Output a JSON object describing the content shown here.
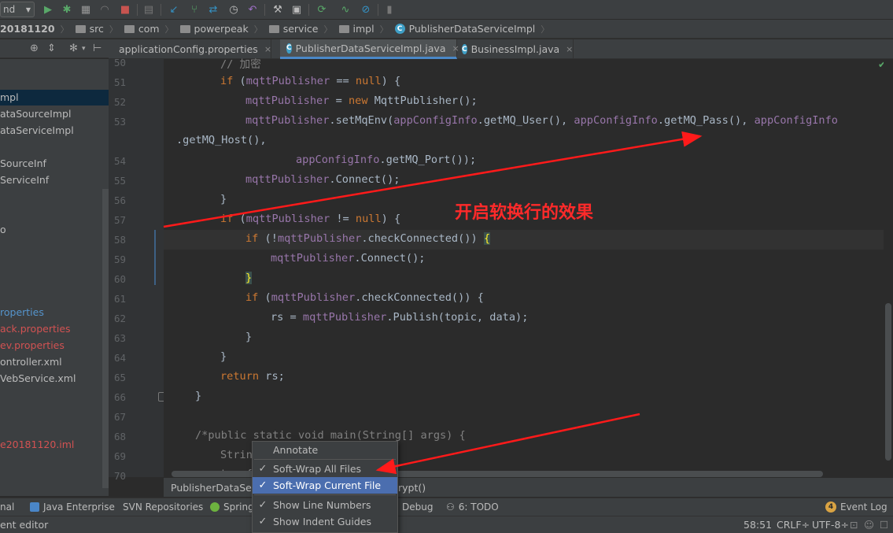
{
  "toolbar": {
    "config_combo": "nd",
    "icons": [
      "run-icon",
      "debug-icon",
      "coverage-icon",
      "profile-icon",
      "stop-icon",
      "build-icon",
      "vcs-update-icon",
      "vcs-commit-icon",
      "vcs-compare-icon",
      "vcs-history-icon",
      "vcs-revert-icon",
      "project-structure-icon",
      "sdk-icon",
      "sync-icon",
      "activity-monitor-icon",
      "no-entry-icon",
      "help-icon"
    ]
  },
  "breadcrumb": {
    "items": [
      "20181120",
      "src",
      "com",
      "powerpeak",
      "service",
      "impl",
      "PublisherDataServiceImpl"
    ]
  },
  "project_tree": {
    "items": [
      {
        "label": "mpl",
        "style": "selected"
      },
      {
        "label": "ataSourceImpl",
        "style": "normal"
      },
      {
        "label": "ataServiceImpl",
        "style": "normal"
      },
      {
        "label": "SourceInf",
        "style": "normal"
      },
      {
        "label": "ServiceInf",
        "style": "normal"
      },
      {
        "label": "o",
        "style": "normal"
      },
      {
        "label": "roperties",
        "style": "blue"
      },
      {
        "label": "ack.properties",
        "style": "red"
      },
      {
        "label": "ev.properties",
        "style": "red"
      },
      {
        "label": "ontroller.xml",
        "style": "normal"
      },
      {
        "label": "VebService.xml",
        "style": "normal"
      },
      {
        "label": "e20181120.iml",
        "style": "red"
      }
    ]
  },
  "tabs": [
    {
      "label": "applicationConfig.properties",
      "active": false
    },
    {
      "label": "PublisherDataServiceImpl.java",
      "active": true
    },
    {
      "label": "BusinessImpl.java",
      "active": false
    }
  ],
  "line_numbers": [
    "50",
    "51",
    "52",
    "53",
    "54",
    "55",
    "56",
    "57",
    "58",
    "59",
    "60",
    "61",
    "62",
    "63",
    "64",
    "65",
    "66",
    "67",
    "68",
    "69",
    "70"
  ],
  "code": {
    "l50": "// 加密",
    "l51_kw": "if",
    "l51_a": " (",
    "l51_f": "mqttPublisher",
    "l51_b": " == ",
    "l51_null": "null",
    "l51_c": ") {",
    "l52_f": "mqttPublisher",
    "l52_a": " = ",
    "l52_new": "new",
    "l52_b": " MqttPublisher();",
    "l53_f": "mqttPublisher",
    "l53_a": ".setMqEnv(",
    "l53_f2": "appConfigInfo",
    "l53_b": ".getMQ_User(), ",
    "l53_f3": "appConfigInfo",
    "l53_c": ".getMQ_Pass(), ",
    "l53_f4": "appConfigInfo",
    "l53w": ".getMQ_Host(),",
    "l54_f": "appConfigInfo",
    "l54_a": ".getMQ_Port());",
    "l55_f": "mqttPublisher",
    "l55_a": ".Connect();",
    "l56": "}",
    "l57_kw": "if",
    "l57_a": " (",
    "l57_f": "mqttPublisher",
    "l57_b": " != ",
    "l57_null": "null",
    "l57_c": ") {",
    "l58_kw": "if",
    "l58_a": " (!",
    "l58_f": "mqttPublisher",
    "l58_b": ".checkConnected()) ",
    "l58_brace": "{",
    "l59_f": "mqttPublisher",
    "l59_a": ".Connect();",
    "l60_brace": "}",
    "l61_kw": "if",
    "l61_a": " (",
    "l61_f": "mqttPublisher",
    "l61_b": ".checkConnected()) {",
    "l62_a": "rs = ",
    "l62_f": "mqttPublisher",
    "l62_b": ".Publish(topic, data);",
    "l63": "}",
    "l64": "}",
    "l65_kw": "return",
    "l65_a": " rs;",
    "l66": "}",
    "l68": "/*public static void main(String[] args) {",
    "l69": "Strin",
    "l70": "try {"
  },
  "nav_bar": {
    "left": "PublisherDataServ",
    "right": "rypt()"
  },
  "context_menu": {
    "items": [
      {
        "label": "Annotate",
        "checked": false,
        "highlighted": false
      },
      {
        "label": "Soft-Wrap All Files",
        "checked": true,
        "highlighted": false
      },
      {
        "label": "Soft-Wrap Current File",
        "checked": true,
        "highlighted": true
      },
      {
        "label": "Show Line Numbers",
        "checked": true,
        "highlighted": false
      },
      {
        "label": "Show Indent Guides",
        "checked": true,
        "highlighted": false
      }
    ],
    "check_glyph": "✓"
  },
  "tool_windows": {
    "terminal": "nal",
    "java_enterprise": "Java Enterprise",
    "svn": "SVN Repositories",
    "spring": "Spring",
    "debug": "Debug",
    "todo": "6: TODO",
    "event_log_count": "4",
    "event_log": "Event Log"
  },
  "status_bar": {
    "message": "ent editor",
    "position": "58:51",
    "line_sep": "CRLF÷",
    "encoding": "UTF-8÷"
  },
  "annotation": {
    "text": "开启软换行的效果",
    "color": "#ff2a2a"
  },
  "colors": {
    "keyword": "#cc7832",
    "field": "#9876aa",
    "comment": "#808080",
    "accent": "#4b6eaf"
  }
}
